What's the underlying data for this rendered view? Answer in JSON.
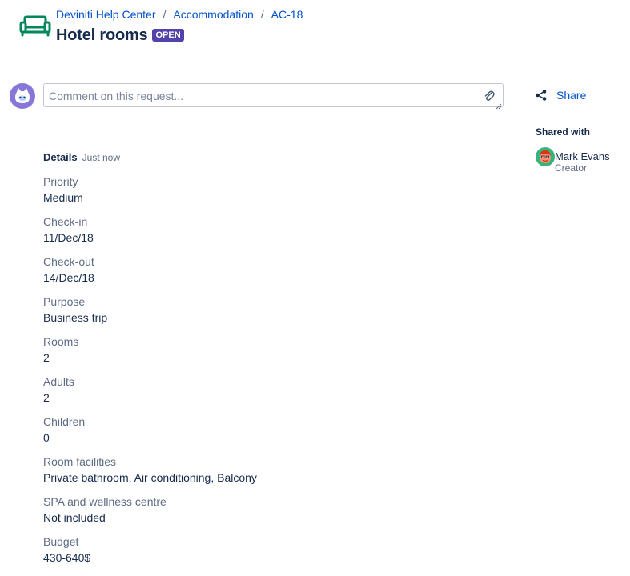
{
  "header": {
    "breadcrumb": [
      "Deviniti Help Center",
      "Accommodation",
      "AC-18"
    ],
    "title": "Hotel rooms",
    "status": "OPEN",
    "icon": "sofa-icon"
  },
  "comment": {
    "placeholder": "Comment on this request..."
  },
  "share": {
    "label": "Share"
  },
  "shared_with": {
    "heading": "Shared with",
    "people": [
      {
        "name": "Mark Evans",
        "role": "Creator"
      }
    ]
  },
  "details": {
    "heading": "Details",
    "time": "Just now",
    "fields": [
      {
        "label": "Priority",
        "value": "Medium"
      },
      {
        "label": "Check-in",
        "value": "11/Dec/18"
      },
      {
        "label": "Check-out",
        "value": "14/Dec/18"
      },
      {
        "label": "Purpose",
        "value": "Business trip"
      },
      {
        "label": "Rooms",
        "value": "2"
      },
      {
        "label": "Adults",
        "value": "2"
      },
      {
        "label": "Children",
        "value": "0"
      },
      {
        "label": "Room facilities",
        "value": "Private bathroom, Air conditioning, Balcony"
      },
      {
        "label": "SPA and wellness centre",
        "value": "Not included"
      },
      {
        "label": "Budget",
        "value": "430-640$"
      }
    ]
  },
  "colors": {
    "accent": "#0052cc",
    "status": "#5243aa",
    "icon": "#00875a"
  }
}
